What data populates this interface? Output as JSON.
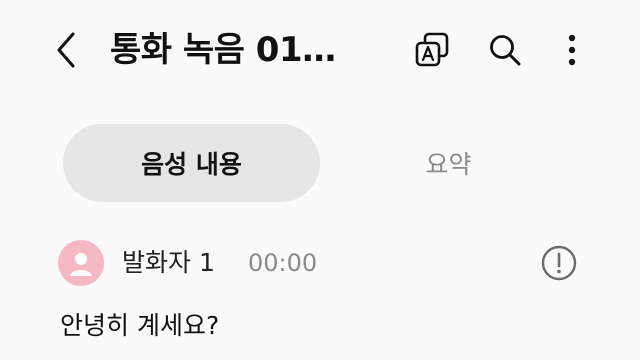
{
  "header": {
    "title": "통화 녹음 01…",
    "icons": {
      "back": "back-chevron-icon",
      "translate": "translate-icon",
      "search": "search-icon",
      "more": "more-vertical-icon"
    }
  },
  "tabs": [
    {
      "label": "음성 내용",
      "selected": true
    },
    {
      "label": "요약",
      "selected": false
    }
  ],
  "transcript": {
    "entries": [
      {
        "speaker": "발화자 1",
        "time": "00:00",
        "text": "안녕히 계세요?",
        "avatar_color": "#f6b9c4"
      }
    ]
  },
  "colors": {
    "background": "#fafafa",
    "tab_active_bg": "#e6e6e6",
    "muted_text": "#8a8a8a",
    "avatar": "#f6b9c4"
  }
}
